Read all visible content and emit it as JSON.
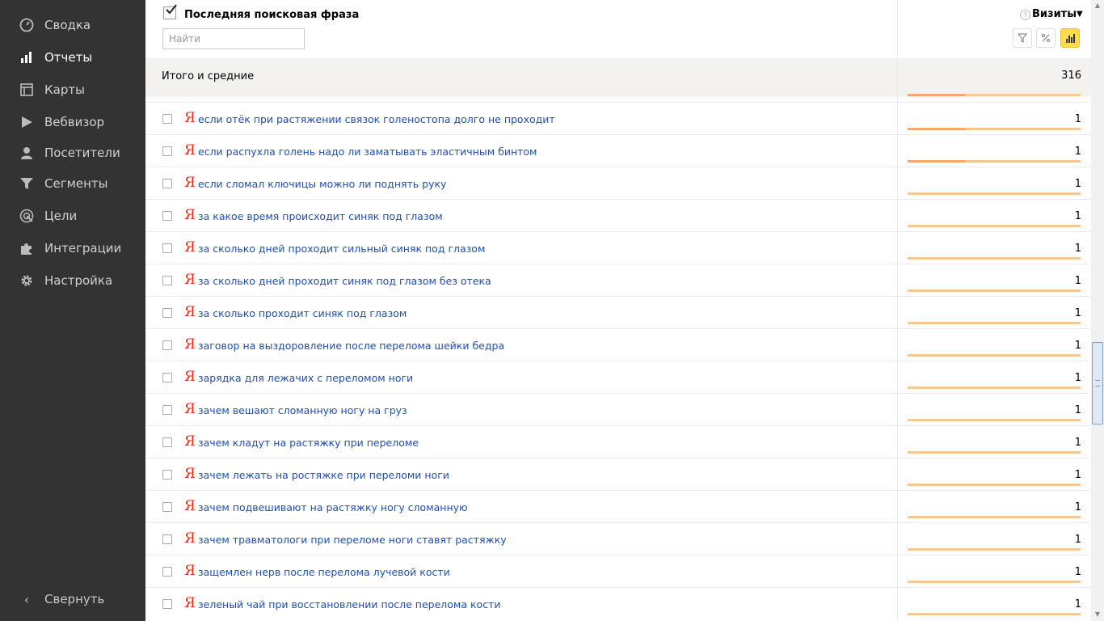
{
  "sidebar": {
    "items": [
      {
        "label": "Сводка",
        "icon": "dashboard-gauge-icon"
      },
      {
        "label": "Отчеты",
        "icon": "bar-chart-icon",
        "active": true
      },
      {
        "label": "Карты",
        "icon": "map-layout-icon"
      },
      {
        "label": "Вебвизор",
        "icon": "play-icon"
      },
      {
        "label": "Посетители",
        "icon": "user-icon"
      },
      {
        "label": "Сегменты",
        "icon": "funnel-icon"
      },
      {
        "label": "Цели",
        "icon": "target-icon"
      },
      {
        "label": "Интеграции",
        "icon": "puzzle-icon"
      },
      {
        "label": "Настройка",
        "icon": "gear-icon"
      }
    ],
    "collapse_label": "Свернуть"
  },
  "header": {
    "dimension_title": "Последняя поисковая фраза",
    "dimension_checked": true,
    "search_placeholder": "Найти",
    "metric_title": "Визиты",
    "metric_sort_indicator": "▼"
  },
  "totals": {
    "label": "Итого и средние",
    "value": "316"
  },
  "rows": [
    {
      "text": "если отёк при растяжении связок голеностопа долго не проходит",
      "value": "1"
    },
    {
      "text": "если распухла голень надо ли заматывать эластичным бинтом",
      "value": "1"
    },
    {
      "text": "если сломал ключицы можно ли поднять руку",
      "value": "1"
    },
    {
      "text": "за какое время происходит синяк под глазом",
      "value": "1"
    },
    {
      "text": "за сколько дней проходит сильный синяк под глазом",
      "value": "1"
    },
    {
      "text": "за сколько дней проходит синяк под глазом без отека",
      "value": "1"
    },
    {
      "text": "за сколько проходит синяк под глазом",
      "value": "1"
    },
    {
      "text": "заговор на выздоровление после перелома шейки бедра",
      "value": "1"
    },
    {
      "text": "зарядка для лежачих с переломом ноги",
      "value": "1"
    },
    {
      "text": "зачем вешают сломанную ногу на груз",
      "value": "1"
    },
    {
      "text": "зачем кладут на растяжку при переломе",
      "value": "1"
    },
    {
      "text": "зачем лежать на ростяжке при перелом­и ноги",
      "value": "1"
    },
    {
      "text": "зачем подвешивают на растяжку ногу сломанную",
      "value": "1"
    },
    {
      "text": "зачем травматологи при переломе ноги ставят растяжку",
      "value": "1"
    },
    {
      "text": "защемлен нерв после перелома лучевой кости",
      "value": "1"
    },
    {
      "text": "зеленый чай при восстановлении после перелома кости",
      "value": "1"
    }
  ],
  "colors": {
    "sidebar_bg": "#333333",
    "link": "#1f4fb0",
    "yandex_logo": "#e62d1d",
    "bar": "#f7c690",
    "bar_fill": "#f5a96d",
    "active_button": "#ffdb4d"
  }
}
